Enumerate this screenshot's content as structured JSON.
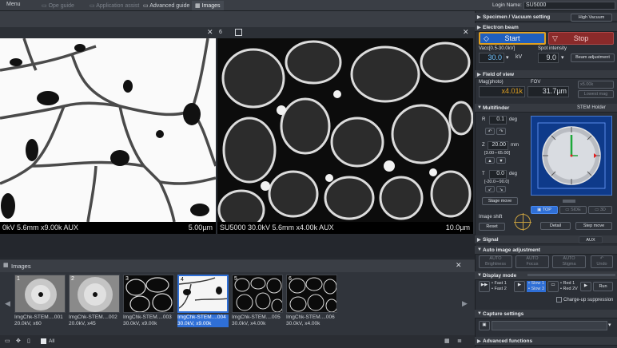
{
  "menubar": {
    "menu": "Menu",
    "tabs": [
      "Ope guide",
      "Application assist",
      "Advanced guide",
      "Images"
    ],
    "login_label": "Login Name:",
    "login_name": "SU5000"
  },
  "viewer": {
    "left_caption": "0kV 5.6mm x9.00k AUX",
    "left_scale": "5.00µm",
    "right_caption": "SU5000 30.0kV 5.6mm x4.00k AUX",
    "right_scale": "10.0µm",
    "right_num": "6"
  },
  "images_panel": {
    "title": "Images",
    "all_label": "All",
    "thumbs": [
      {
        "num": "1",
        "name": "ImgChk-STEM....001",
        "info": "20.0kV, x60"
      },
      {
        "num": "2",
        "name": "ImgChk-STEM....002",
        "info": "20.0kV, x45"
      },
      {
        "num": "3",
        "name": "ImgChk-STEM....003",
        "info": "30.0kV, x9.00k"
      },
      {
        "num": "4",
        "name": "ImgChk-STEM....004",
        "info": "30.0kV, x9.00k"
      },
      {
        "num": "5",
        "name": "ImgChk-STEM....005",
        "info": "30.0kV, x4.00k"
      },
      {
        "num": "6",
        "name": "ImgChk-STEM....006",
        "info": "30.0kV, x4.00k"
      }
    ]
  },
  "right": {
    "specimen": "Specimen / Vacuum setting",
    "vacuum": "High Vacuum",
    "beam": "Electron beam",
    "start": "Start",
    "stop": "Stop",
    "vacc_label": "Vacc[0.5-30.0kV]",
    "vacc": "30.0",
    "vacc_unit": "kV",
    "spot_label": "Spot intensity",
    "spot": "9.0",
    "beam_adj": "Beam adjustment",
    "fov": "Field of view",
    "mag_label": "Mag(photo)",
    "fov_label": "FOV",
    "mag": "x4.01k",
    "fov_val": "31.7µm",
    "mag_sel": "x5.00k",
    "lowest": "Lowest mag",
    "multifinder": "Multifinder",
    "stem_holder": "STEM Holder",
    "r_label": "R",
    "r_val": "0.1",
    "r_unit": "deg",
    "z_label": "Z",
    "z_val": "20.00",
    "z_unit": "mm",
    "z_range": "[3.00∼65.00]",
    "t_label": "T",
    "t_val": "0.0",
    "t_unit": "deg",
    "t_range": "[-20.0∼90.0]",
    "stage_move": "Stage move",
    "top": "TOP",
    "side": "SIDE",
    "view3d": "3D",
    "image_shift": "Image shift",
    "reset": "Reset",
    "detail": "Detail",
    "step_move": "Step move",
    "signal": "Signal",
    "aux": "AUX",
    "auto_adj": "Auto image adjustment",
    "auto_b": "AUTO",
    "brightness": "Brightness",
    "focus": "Focus",
    "stigma": "Stigma",
    "undo": "Undo",
    "display_mode": "Display mode",
    "fast1": "Fast 1",
    "fast2": "Fast 2",
    "slow1": "Slow 1",
    "slow3": "Slow 3",
    "red1": "Red 1",
    "red2v": "Red 2V",
    "run": "Run",
    "charge": "Charge-up suppression",
    "capture": "Capture settings",
    "advanced": "Advanced functions"
  },
  "colors": {
    "accent": "#2f6fd6",
    "start": "#1f5fbf",
    "stop": "#8a2a2a"
  }
}
